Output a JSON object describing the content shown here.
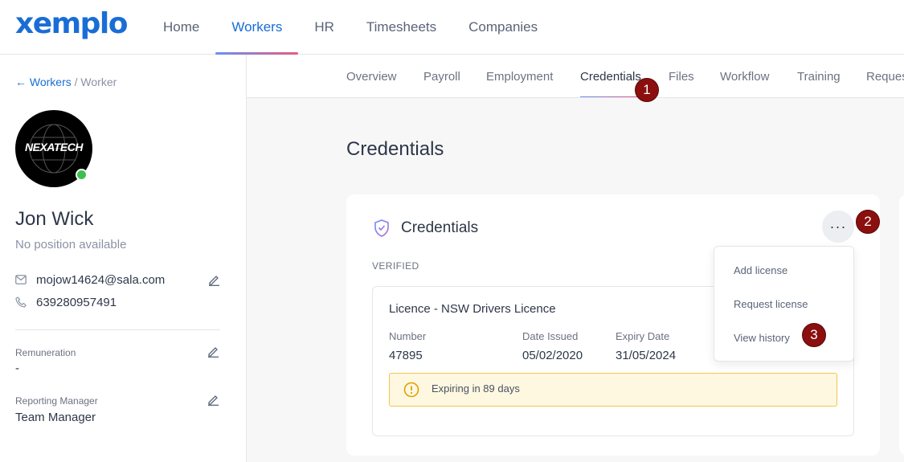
{
  "brand": {
    "logo_text": "xemplo",
    "color": "#1a6dd6"
  },
  "topnav": {
    "items": [
      {
        "label": "Home",
        "active": false
      },
      {
        "label": "Workers",
        "active": true
      },
      {
        "label": "HR",
        "active": false
      },
      {
        "label": "Timesheets",
        "active": false
      },
      {
        "label": "Companies",
        "active": false
      }
    ]
  },
  "breadcrumb": {
    "parent": "← Workers",
    "separator": "/",
    "current": "Worker"
  },
  "worker": {
    "avatar_text": "NEXATECH",
    "name": "Jon Wick",
    "position": "No position available",
    "email": "mojow14624@sala.com",
    "phone": "639280957491",
    "remuneration_label": "Remuneration",
    "remuneration_value": "-",
    "manager_label": "Reporting Manager",
    "manager_value": "Team Manager",
    "status_color": "#3dbf4f"
  },
  "subtabs": [
    {
      "label": "Overview",
      "active": false
    },
    {
      "label": "Payroll",
      "active": false
    },
    {
      "label": "Employment",
      "active": false
    },
    {
      "label": "Credentials",
      "active": true
    },
    {
      "label": "Files",
      "active": false
    },
    {
      "label": "Workflow",
      "active": false
    },
    {
      "label": "Training",
      "active": false
    },
    {
      "label": "Reques",
      "active": false
    }
  ],
  "page": {
    "title": "Credentials"
  },
  "card": {
    "title": "Credentials",
    "more_label": "···",
    "section_label": "VERIFIED",
    "licence": {
      "name": "Licence - NSW Drivers Licence",
      "number_label": "Number",
      "number_value": "47895",
      "issued_label": "Date Issued",
      "issued_value": "05/02/2020",
      "expiry_label": "Expiry Date",
      "expiry_value": "31/05/2024",
      "warning": "Expiring in 89 days"
    }
  },
  "dropdown": {
    "items": [
      "Add license",
      "Request license",
      "View history"
    ]
  },
  "markers": [
    "1",
    "2",
    "3"
  ]
}
